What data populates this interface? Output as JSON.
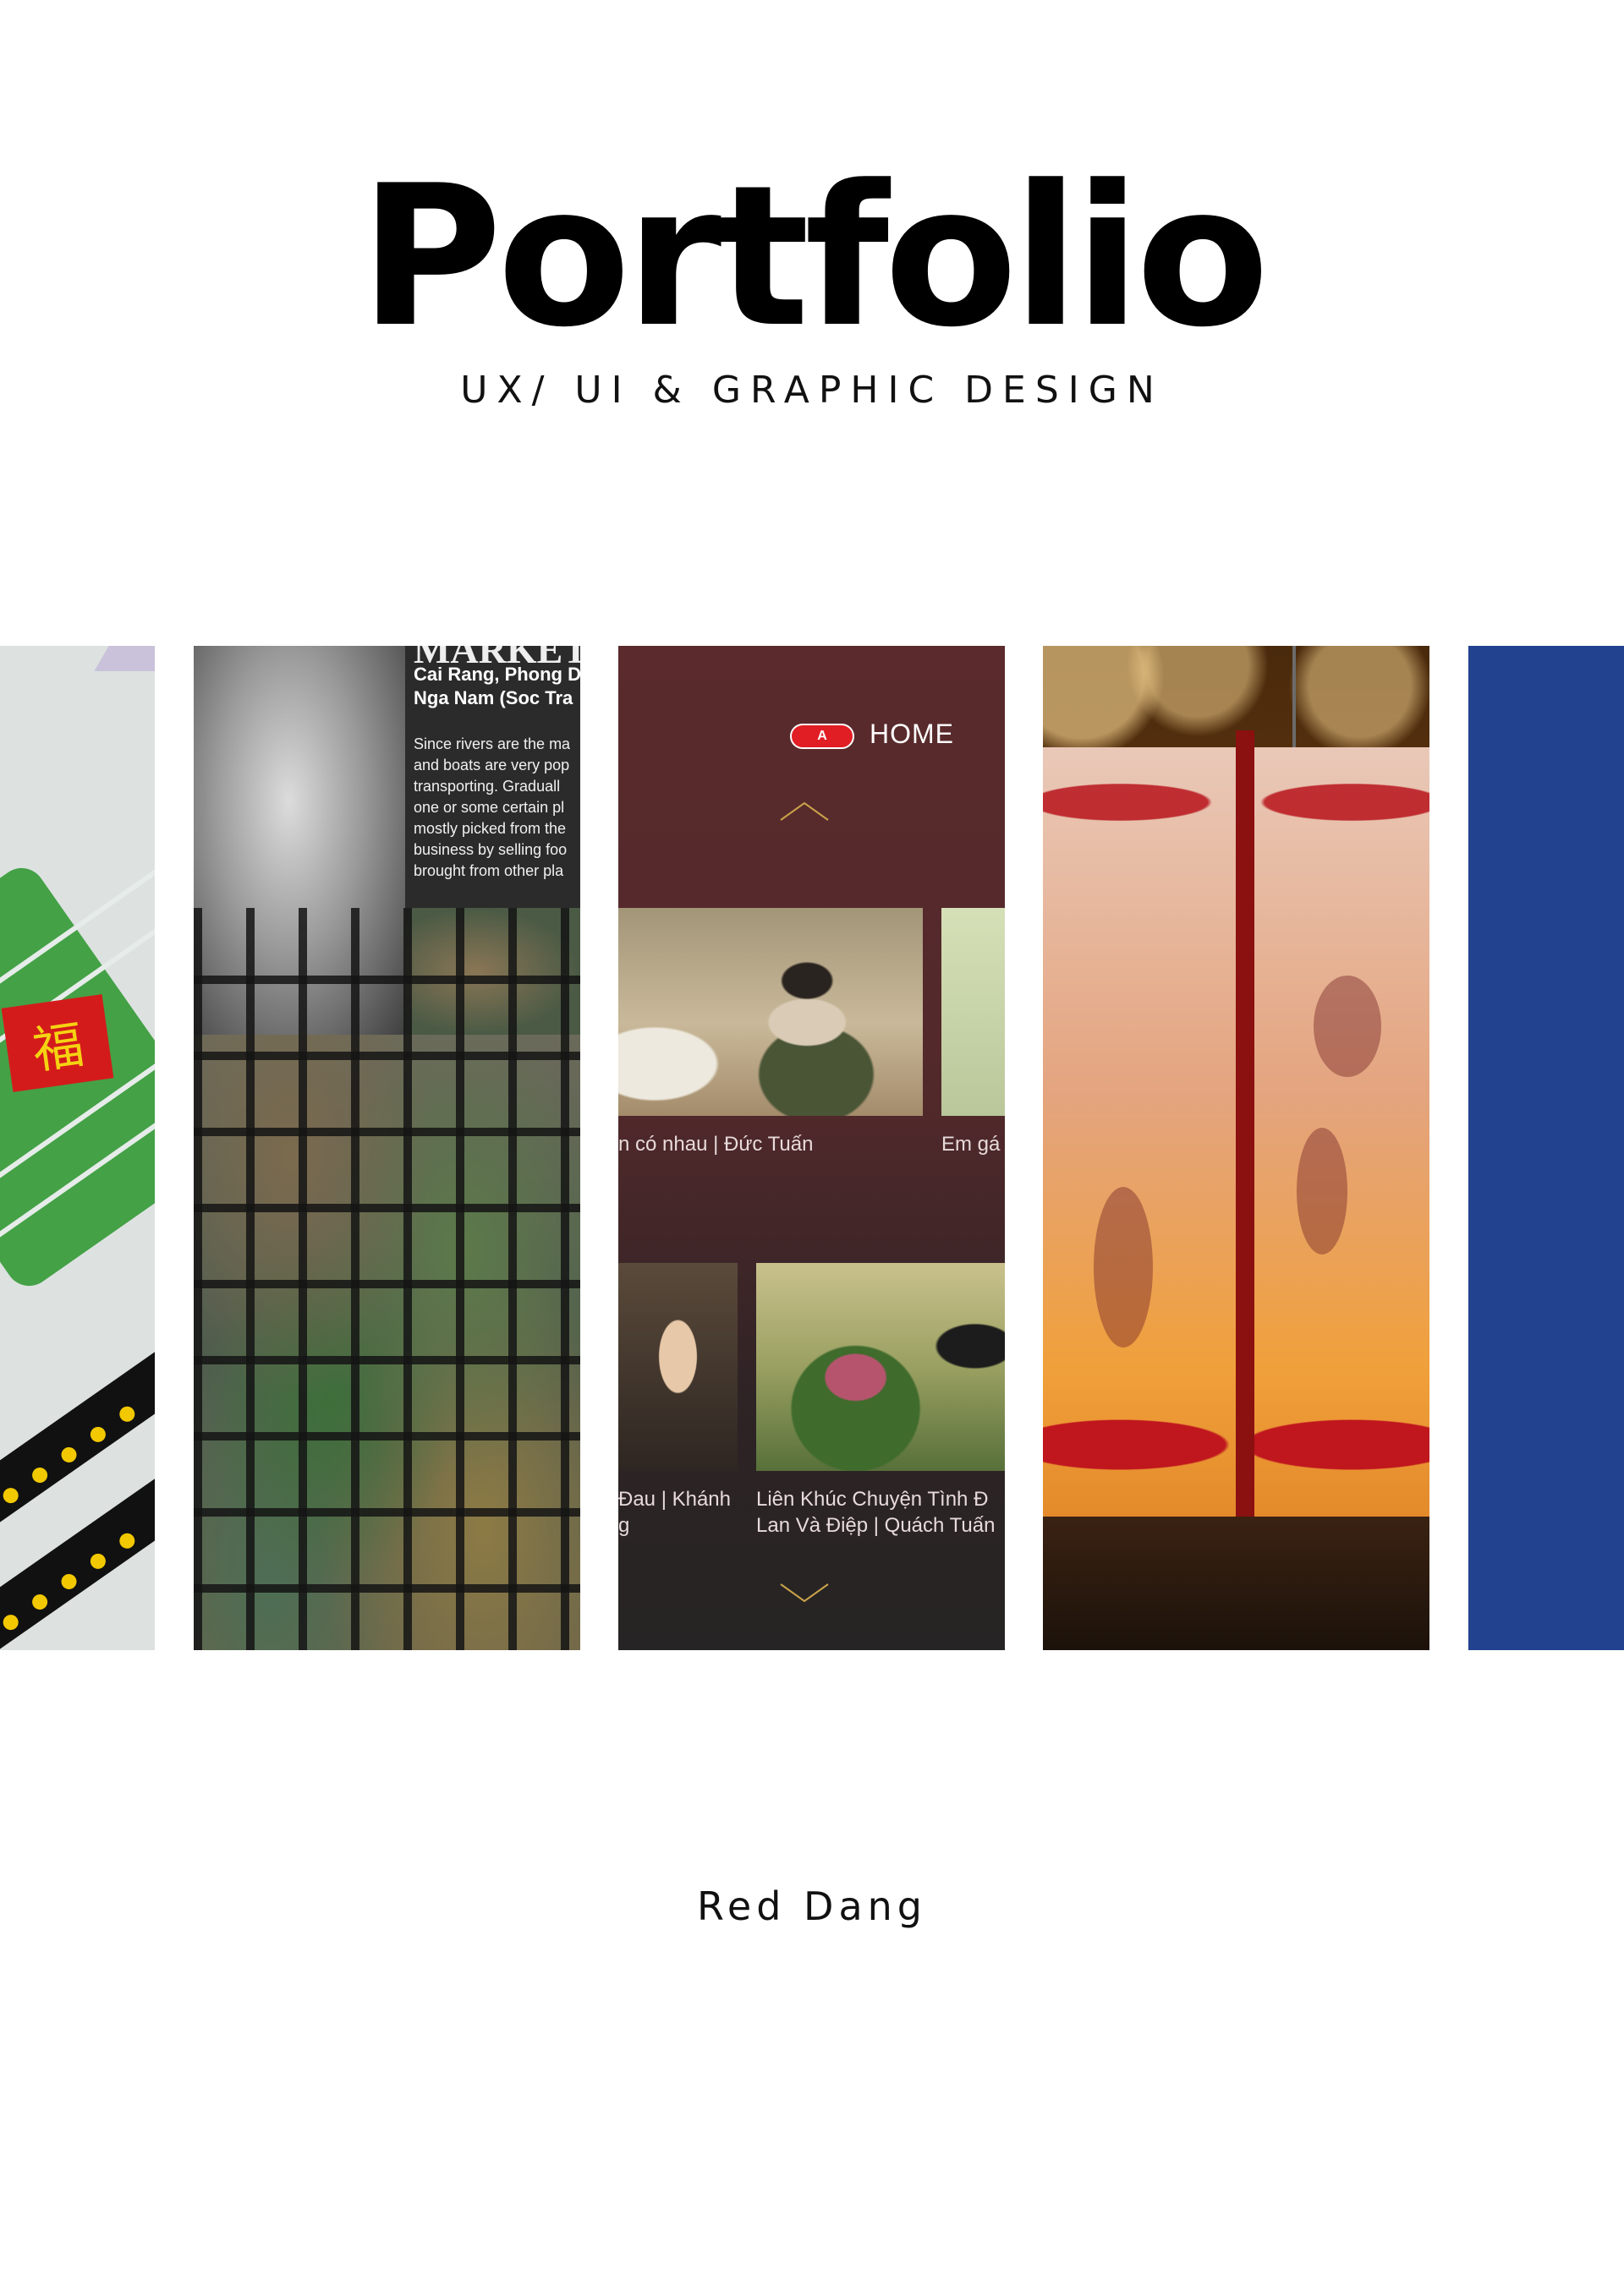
{
  "header": {
    "title": "Portfolio",
    "subtitle": "UX/ UI & GRAPHIC DESIGN"
  },
  "footer": {
    "author": "Red Dang"
  },
  "panels": {
    "card": {
      "seal_char": "福"
    },
    "market": {
      "heading": "MARKET",
      "places": "Cai Rang, Phong D\nNga Nam (Soc Tra",
      "body": "Since rivers are the ma\nand boats are very pop\ntransporting. Graduall\none or some certain pl\nmostly picked from the\nbusiness by selling foo\nbrought from other pla"
    },
    "music_app": {
      "badge": "A",
      "nav_label": "HOME",
      "caption_1": "n có nhau | Đức Tuấn",
      "caption_2": "Em gá",
      "caption_3": "Đau | Khánh\ng",
      "caption_4": "Liên Khúc Chuyện Tình Đ\nLan Và Điệp | Quách Tuấn"
    }
  },
  "colors": {
    "music_bg": "#5a2a2c",
    "badge_red": "#e01e24",
    "blue_panel": "#22418f",
    "card_green": "#44a146"
  }
}
